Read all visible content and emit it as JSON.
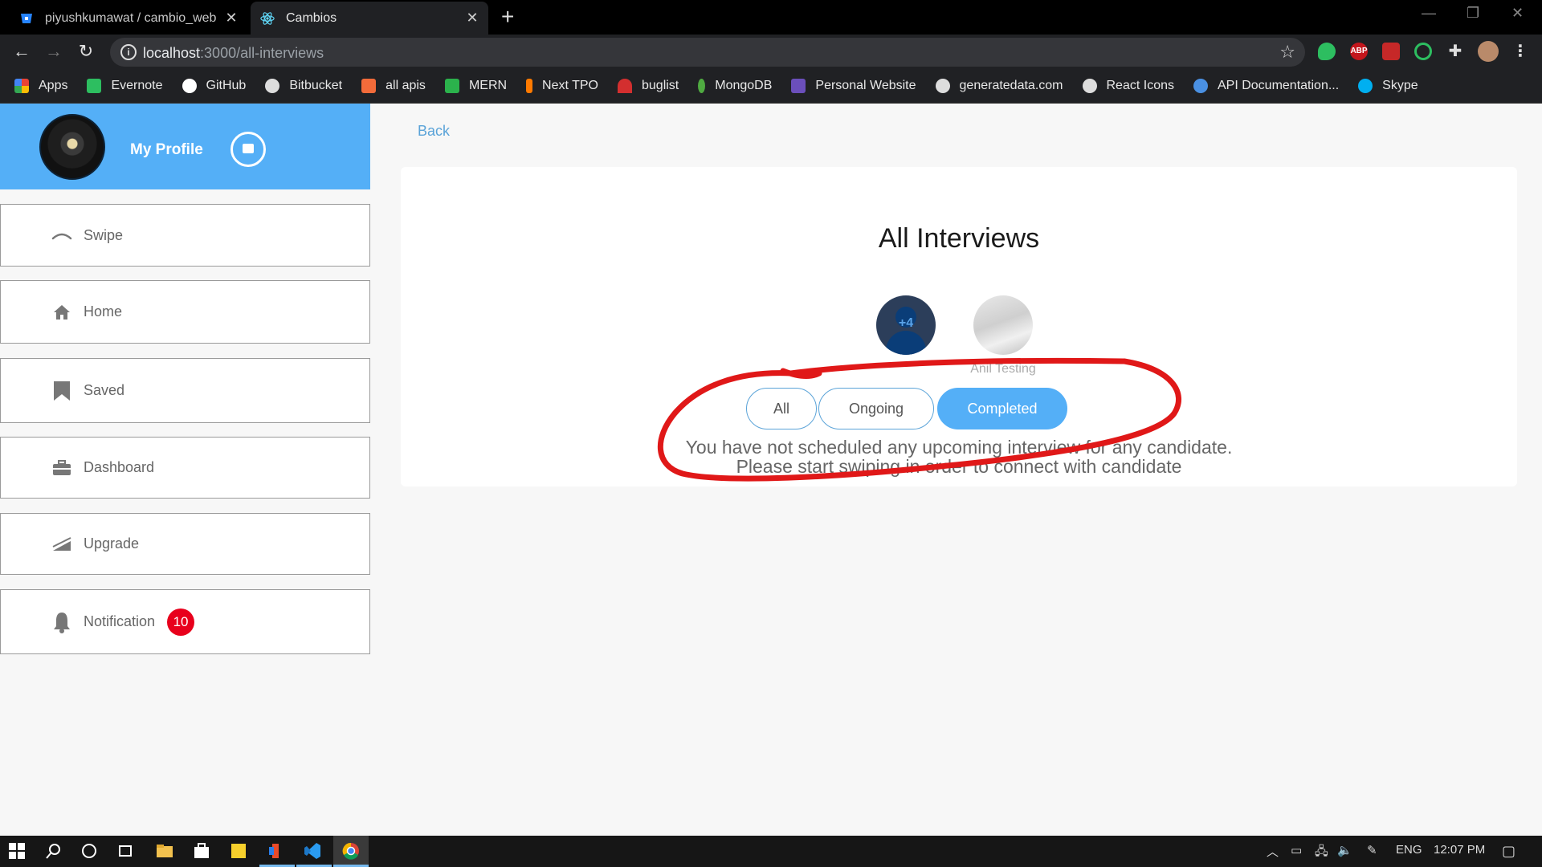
{
  "browser": {
    "tabs": [
      {
        "title": "piyushkumawat / cambio_web —",
        "favicon": "bitbucket-icon",
        "active": false
      },
      {
        "title": "Cambios",
        "favicon": "react-icon",
        "active": true
      }
    ],
    "url_host": "localhost",
    "url_path": ":3000/all-interviews",
    "bookmarks": [
      {
        "label": "Apps",
        "icon": "apps-grid-icon",
        "color": "#e94235"
      },
      {
        "label": "Evernote",
        "icon": "evernote-icon",
        "color": "#2dbe60"
      },
      {
        "label": "GitHub",
        "icon": "github-icon",
        "color": "#ffffff"
      },
      {
        "label": "Bitbucket",
        "icon": "globe-icon",
        "color": "#ffffff"
      },
      {
        "label": "all apis",
        "icon": "all-apis-icon",
        "color": "#f26b3a"
      },
      {
        "label": "MERN",
        "icon": "mern-icon",
        "color": "#2bb24c"
      },
      {
        "label": "Next TPO",
        "icon": "next-tpo-icon",
        "color": "#ff7a00"
      },
      {
        "label": "buglist",
        "icon": "buglist-icon",
        "color": "#d32f2f"
      },
      {
        "label": "MongoDB",
        "icon": "mongodb-icon",
        "color": "#4faa41"
      },
      {
        "label": "Personal Website",
        "icon": "personal-website-icon",
        "color": "#6b4fbb"
      },
      {
        "label": "generatedata.com",
        "icon": "globe-icon",
        "color": "#ffffff"
      },
      {
        "label": "React Icons",
        "icon": "globe-icon",
        "color": "#ffffff"
      },
      {
        "label": "API Documentation...",
        "icon": "api-doc-icon",
        "color": "#4a90e2"
      },
      {
        "label": "Skype",
        "icon": "skype-icon",
        "color": "#00aff0"
      }
    ]
  },
  "sidebar": {
    "profile_label": "My Profile",
    "items": [
      {
        "label": "Swipe",
        "icon": "swipe-icon"
      },
      {
        "label": "Home",
        "icon": "home-icon"
      },
      {
        "label": "Saved",
        "icon": "bookmark-icon"
      },
      {
        "label": "Dashboard",
        "icon": "briefcase-icon"
      },
      {
        "label": "Upgrade",
        "icon": "upgrade-icon"
      },
      {
        "label": "Notification",
        "icon": "bell-icon",
        "badge": "10"
      }
    ]
  },
  "main": {
    "back_label": "Back",
    "title": "All Interviews",
    "candidates": [
      {
        "overlay": "+4",
        "name": ""
      },
      {
        "overlay": "",
        "name": "Anil Testing"
      }
    ],
    "filters": [
      {
        "label": "All",
        "active": false
      },
      {
        "label": "Ongoing",
        "active": false
      },
      {
        "label": "Completed",
        "active": true
      }
    ],
    "empty_line1": "You have not scheduled any upcoming interview for any candidate.",
    "empty_line2": "Please start swiping in order to connect with candidate"
  },
  "taskbar": {
    "language": "ENG",
    "time": "12:07 PM"
  },
  "colors": {
    "accent": "#54aff7",
    "badge": "#e8001c",
    "annotation": "#e01818"
  }
}
